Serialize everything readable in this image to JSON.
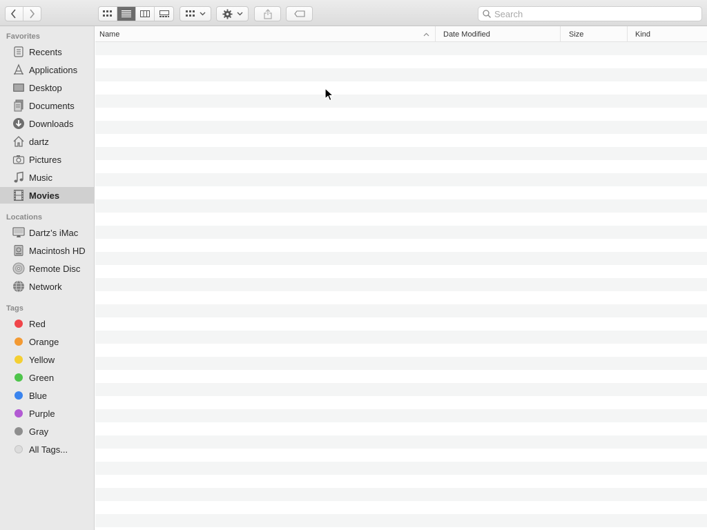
{
  "toolbar": {
    "search_placeholder": "Search"
  },
  "sidebar": {
    "favorites_header": "Favorites",
    "favorites": [
      {
        "label": "Recents",
        "icon": "clock-icon"
      },
      {
        "label": "Applications",
        "icon": "applications-icon"
      },
      {
        "label": "Desktop",
        "icon": "desktop-icon"
      },
      {
        "label": "Documents",
        "icon": "document-icon"
      },
      {
        "label": "Downloads",
        "icon": "download-icon"
      },
      {
        "label": "dartz",
        "icon": "home-icon"
      },
      {
        "label": "Pictures",
        "icon": "camera-icon"
      },
      {
        "label": "Music",
        "icon": "music-note-icon"
      },
      {
        "label": "Movies",
        "icon": "film-icon",
        "selected": true
      }
    ],
    "locations_header": "Locations",
    "locations": [
      {
        "label": "Dartz’s iMac",
        "icon": "imac-icon"
      },
      {
        "label": "Macintosh HD",
        "icon": "hard-drive-icon"
      },
      {
        "label": "Remote Disc",
        "icon": "disc-icon"
      },
      {
        "label": "Network",
        "icon": "globe-icon"
      }
    ],
    "tags_header": "Tags",
    "tags": [
      {
        "label": "Red",
        "color": "#f0454a"
      },
      {
        "label": "Orange",
        "color": "#f39a33"
      },
      {
        "label": "Yellow",
        "color": "#f4cf33"
      },
      {
        "label": "Green",
        "color": "#4ec44b"
      },
      {
        "label": "Blue",
        "color": "#3a84ee"
      },
      {
        "label": "Purple",
        "color": "#b25ad3"
      },
      {
        "label": "Gray",
        "color": "#8e8e8e"
      },
      {
        "label": "All Tags...",
        "color": "#dcdcdc"
      }
    ]
  },
  "columns": {
    "name": "Name",
    "date_modified": "Date Modified",
    "size": "Size",
    "kind": "Kind"
  }
}
